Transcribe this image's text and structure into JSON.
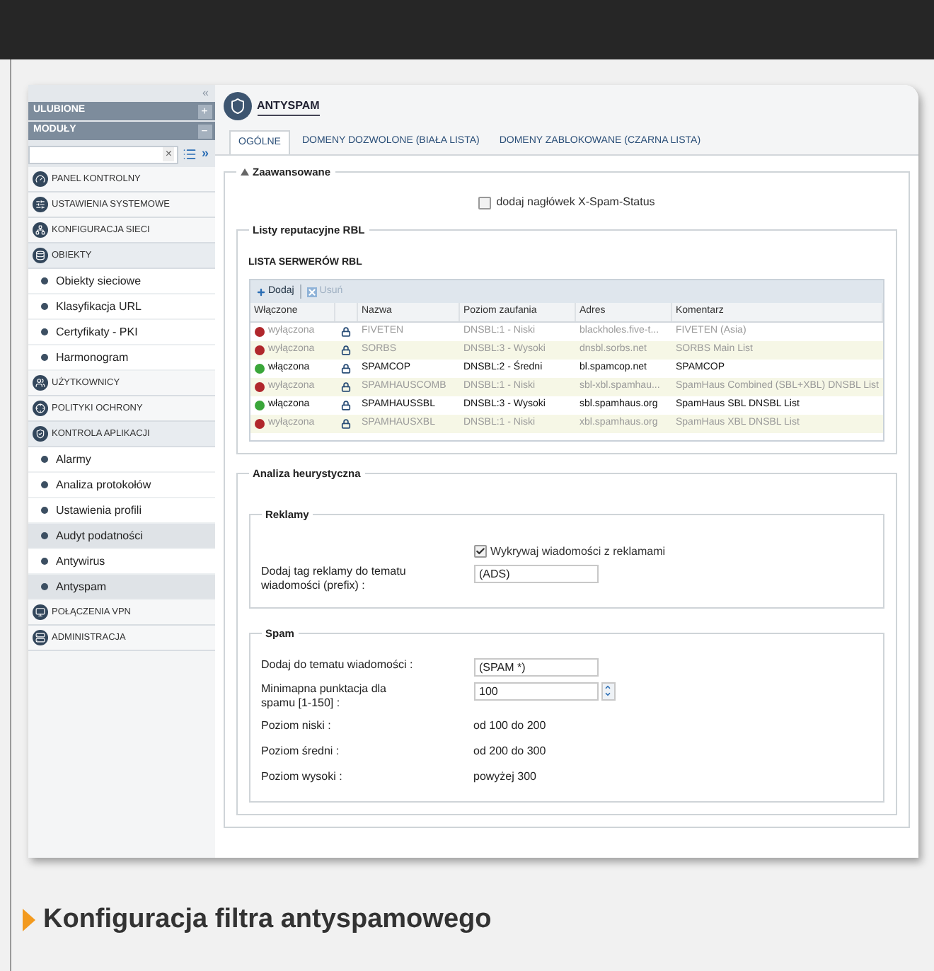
{
  "sidebar": {
    "collapse_glyph": "«",
    "sections": [
      {
        "label": "ULUBIONE",
        "toggle": "+"
      },
      {
        "label": "MODUŁY",
        "toggle": "−"
      }
    ],
    "search": {
      "clear": "×",
      "more": "»"
    },
    "items": [
      {
        "label": "PANEL KONTROLNY",
        "expanded": false
      },
      {
        "label": "USTAWIENIA SYSTEMOWE",
        "expanded": false
      },
      {
        "label": "KONFIGURACJA SIECI",
        "expanded": false
      },
      {
        "label": "OBIEKTY",
        "expanded": true,
        "children": [
          {
            "label": "Obiekty sieciowe",
            "highlighted": false
          },
          {
            "label": "Klasyfikacja URL",
            "highlighted": false
          },
          {
            "label": "Certyfikaty - PKI",
            "highlighted": false
          },
          {
            "label": "Harmonogram",
            "highlighted": false
          }
        ]
      },
      {
        "label": "UŻYTKOWNICY",
        "expanded": false
      },
      {
        "label": "POLITYKI OCHRONY",
        "expanded": false
      },
      {
        "label": "KONTROLA APLIKACJI",
        "expanded": true,
        "children": [
          {
            "label": "Alarmy",
            "highlighted": false
          },
          {
            "label": "Analiza protokołów",
            "highlighted": false
          },
          {
            "label": "Ustawienia profili",
            "highlighted": false
          },
          {
            "label": "Audyt podatności",
            "highlighted": true
          },
          {
            "label": "Antywirus",
            "highlighted": false
          },
          {
            "label": "Antyspam",
            "highlighted": true
          }
        ]
      },
      {
        "label": "POŁĄCZENIA VPN",
        "expanded": false
      },
      {
        "label": "ADMINISTRACJA",
        "expanded": false
      }
    ]
  },
  "main": {
    "title": "ANTYSPAM",
    "tabs": [
      {
        "label": "OGÓLNE",
        "selected": true
      },
      {
        "label": "DOMENY DOZWOLONE (BIAŁA LISTA)",
        "selected": false
      },
      {
        "label": "DOMENY ZABLOKOWANE (CZARNA LISTA)",
        "selected": false
      }
    ],
    "advanced": {
      "legend": "Zaawansowane",
      "expanded": true,
      "checkbox": {
        "label": "dodaj nagłówek X-Spam-Status",
        "checked": false
      },
      "rbl": {
        "legend": "Listy reputacyjne RBL",
        "list_title": "LISTA SERWERÓW RBL",
        "toolbar": [
          {
            "label": "Dodaj",
            "kind": "add",
            "disabled": false
          },
          {
            "label": "Usuń",
            "kind": "remove",
            "disabled": true
          }
        ],
        "columns": [
          "Włączone",
          "Nazwa",
          "Poziom zaufania",
          "Adres",
          "Komentarz"
        ],
        "rows": [
          {
            "enabled": false,
            "color": "#b0272c",
            "status": "wyłączona",
            "name": "FIVETEN",
            "level": "DNSBL:1 - Niski",
            "address": "blackholes.five-t...",
            "comment": "FIVETEN (Asia)"
          },
          {
            "enabled": false,
            "color": "#b0272c",
            "status": "wyłączona",
            "name": "SORBS",
            "level": "DNSBL:3 - Wysoki",
            "address": "dnsbl.sorbs.net",
            "comment": "SORBS Main List"
          },
          {
            "enabled": true,
            "color": "#3aa63a",
            "status": "włączona",
            "name": "SPAMCOP",
            "level": "DNSBL:2 - Średni",
            "address": "bl.spamcop.net",
            "comment": "SPAMCOP"
          },
          {
            "enabled": false,
            "color": "#b0272c",
            "status": "wyłączona",
            "name": "SPAMHAUSCOMB",
            "level": "DNSBL:1 - Niski",
            "address": "sbl-xbl.spamhau...",
            "comment": "SpamHaus Combined (SBL+XBL) DNSBL List"
          },
          {
            "enabled": true,
            "color": "#3aa63a",
            "status": "włączona",
            "name": "SPAMHAUSSBL",
            "level": "DNSBL:3 - Wysoki",
            "address": "sbl.spamhaus.org",
            "comment": "SpamHaus SBL DNSBL List"
          },
          {
            "enabled": false,
            "color": "#b0272c",
            "status": "wyłączona",
            "name": "SPAMHAUSXBL",
            "level": "DNSBL:1 - Niski",
            "address": "xbl.spamhaus.org",
            "comment": "SpamHaus XBL DNSBL List"
          }
        ]
      },
      "heuristic": {
        "legend": "Analiza heurystyczna",
        "ads": {
          "legend": "Reklamy",
          "checkbox": {
            "label": "Wykrywaj wiadomości z reklamami",
            "checked": true
          },
          "field": {
            "label": "Dodaj tag reklamy do tematu wiadomości (prefix) :",
            "value": "(ADS)"
          }
        },
        "spam": {
          "legend": "Spam",
          "fields": [
            {
              "kind": "text",
              "label": "Dodaj do tematu wiadomości :",
              "value": "(SPAM *)"
            },
            {
              "kind": "spinner",
              "label": "Minimapna punktacja dla spamu [1-150] :",
              "value": "100"
            }
          ],
          "levels": [
            {
              "label": "Poziom niski :",
              "value": "od 100 do 200"
            },
            {
              "label": "Poziom średni :",
              "value": "od 200 do 300"
            },
            {
              "label": "Poziom wysoki :",
              "value": "powyżej 300"
            }
          ]
        }
      }
    }
  },
  "caption": "Konfiguracja filtra antyspamowego"
}
